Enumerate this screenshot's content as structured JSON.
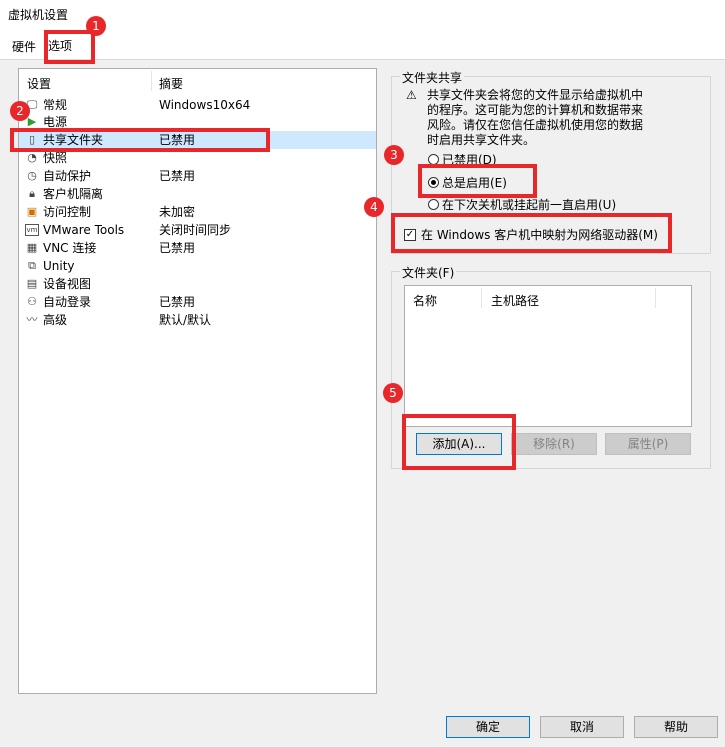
{
  "window": {
    "title": "虚拟机设置"
  },
  "tabs": [
    {
      "label": "硬件"
    },
    {
      "label": "选项"
    }
  ],
  "left": {
    "col_setting": "设置",
    "col_summary": "摘要",
    "items": [
      {
        "name": "常规",
        "summary": "Windows10x64",
        "icon": "monitor-icon"
      },
      {
        "name": "电源",
        "summary": "",
        "icon": "play-icon"
      },
      {
        "name": "共享文件夹",
        "summary": "已禁用",
        "icon": "shared-folder-icon"
      },
      {
        "name": "快照",
        "summary": "",
        "icon": "snapshot-icon"
      },
      {
        "name": "自动保护",
        "summary": "已禁用",
        "icon": "clock-icon"
      },
      {
        "name": "客户机隔离",
        "summary": "",
        "icon": "lock-icon"
      },
      {
        "name": "访问控制",
        "summary": "未加密",
        "icon": "access-control-icon"
      },
      {
        "name": "VMware Tools",
        "summary": "关闭时间同步",
        "icon": "vm-icon"
      },
      {
        "name": "VNC 连接",
        "summary": "已禁用",
        "icon": "vnc-icon"
      },
      {
        "name": "Unity",
        "summary": "",
        "icon": "unity-icon"
      },
      {
        "name": "设备视图",
        "summary": "",
        "icon": "device-view-icon"
      },
      {
        "name": "自动登录",
        "summary": "已禁用",
        "icon": "users-icon"
      },
      {
        "name": "高级",
        "summary": "默认/默认",
        "icon": "pulse-icon"
      }
    ]
  },
  "sharing": {
    "group_title": "文件夹共享",
    "warning_lines": [
      "共享文件夹会将您的文件显示给虚拟机中",
      "的程序。这可能为您的计算机和数据带来",
      "风险。请仅在您信任虚拟机使用您的数据",
      "时启用共享文件夹。"
    ],
    "options": [
      {
        "label": "已禁用(D)",
        "selected": false
      },
      {
        "label": "总是启用(E)",
        "selected": true
      },
      {
        "label": "在下次关机或挂起前一直启用(U)",
        "selected": false
      }
    ],
    "map_drive_label": "在 Windows 客户机中映射为网络驱动器(M)",
    "map_drive_checked": true
  },
  "folders": {
    "group_title": "文件夹(F)",
    "col_name": "名称",
    "col_host_path": "主机路径",
    "add_label": "添加(A)...",
    "remove_label": "移除(R)",
    "props_label": "属性(P)"
  },
  "footer": {
    "ok": "确定",
    "cancel": "取消",
    "help": "帮助"
  },
  "annotations": [
    "1",
    "2",
    "3",
    "4",
    "5"
  ],
  "colors": {
    "annotation": "#e8272b",
    "selection": "#cde8ff"
  }
}
